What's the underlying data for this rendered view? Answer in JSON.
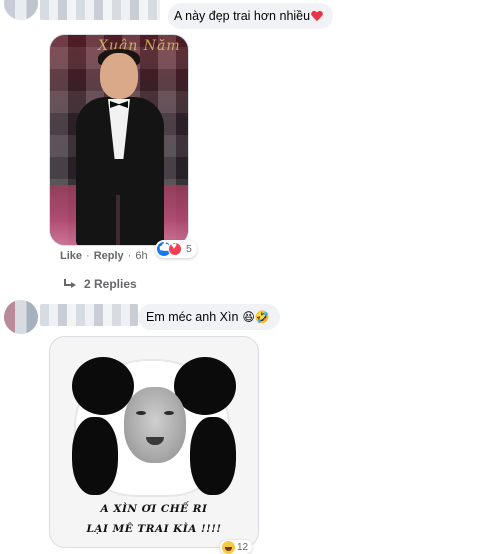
{
  "comments": [
    {
      "text": "A này đẹp trai hơn nhiều",
      "photo_overlay_text": "Xuân Năm",
      "reactions_count": "5",
      "actions": {
        "like": "Like",
        "separator": "·",
        "reply": "Reply",
        "time": "6h"
      },
      "replies_label": "2 Replies"
    },
    {
      "text": "Em méc anh Xìn",
      "emoji": "😆🤣",
      "meme_text_line1": "A XÌN ƠI CHẾ RI",
      "meme_text_line2": "LẠI MÊ TRAI KÌA !!!!",
      "reactions_count": "12"
    }
  ],
  "colors": {
    "bubble": "#f0f2f5",
    "like_blue": "#1877f2",
    "heart_red": "#f33e58",
    "meta_gray": "#65676b"
  }
}
